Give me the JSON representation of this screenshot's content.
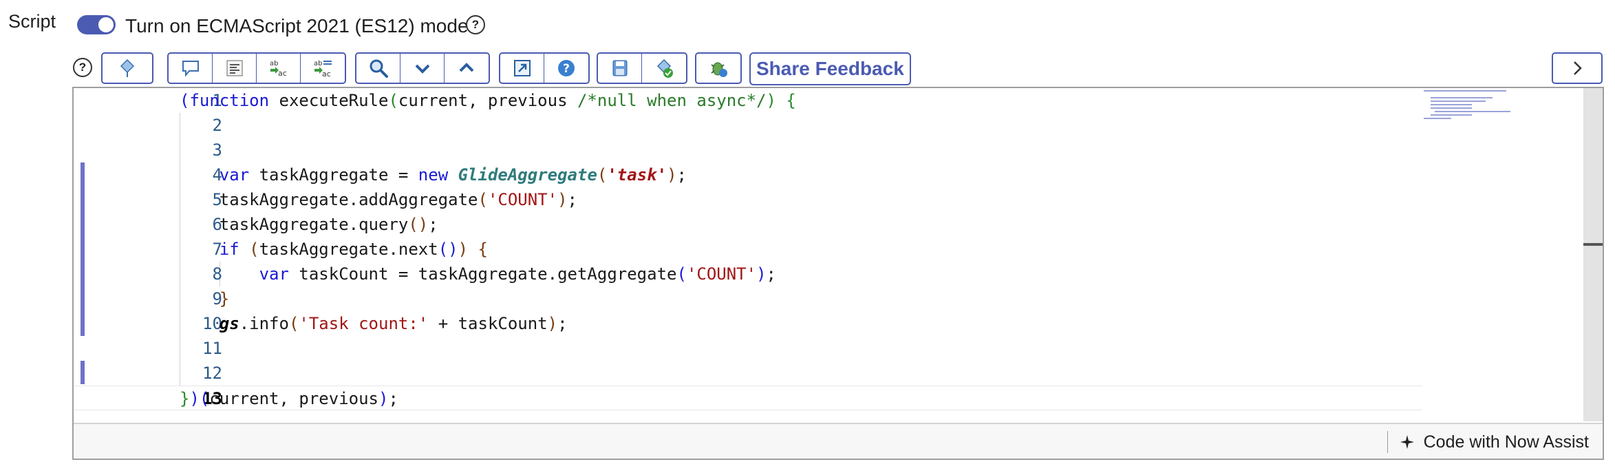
{
  "field": {
    "label": "Script"
  },
  "es_mode": {
    "label": "Turn on ECMAScript 2021 (ES12) mode",
    "enabled": true
  },
  "toolbar": {
    "buttons": [
      "help-icon",
      "script-include-icon",
      "comment-icon",
      "format-icon",
      "replace-icon",
      "replace-all-icon",
      "search-icon",
      "next-icon",
      "previous-icon",
      "fullscreen-icon",
      "info-icon",
      "save-icon",
      "check-syntax-icon",
      "debug-icon"
    ],
    "share_feedback": "Share Feedback"
  },
  "editor": {
    "lines": [
      "1",
      "2",
      "3",
      "4",
      "5",
      "6",
      "7",
      "8",
      "9",
      "10",
      "11",
      "12",
      "13"
    ],
    "active_line": "13",
    "code": {
      "l1_kw": "(function",
      "l1_name": " executeRule",
      "l1_args": "current, previous ",
      "l1_comment": "/*null when async*/",
      "l4_var": "var",
      "l4_name": " taskAggregate = ",
      "l4_new": "new",
      "l4_cls": "GlideAggregate",
      "l4_str": "'task'",
      "l5_a": "taskAggregate.addAggregate",
      "l5_str": "'COUNT'",
      "l6_a": "taskAggregate.query",
      "l7_if": "if",
      "l7_a": "taskAggregate.next",
      "l8_var": "var",
      "l8_a": " taskCount = taskAggregate.getAggregate",
      "l8_str": "'COUNT'",
      "l10_gs": "gs",
      "l10_a": ".info",
      "l10_str": "'Task count:'",
      "l10_b": " + taskCount",
      "l13_a": "current, previous"
    }
  },
  "status": {
    "assist": "Code with Now Assist"
  }
}
